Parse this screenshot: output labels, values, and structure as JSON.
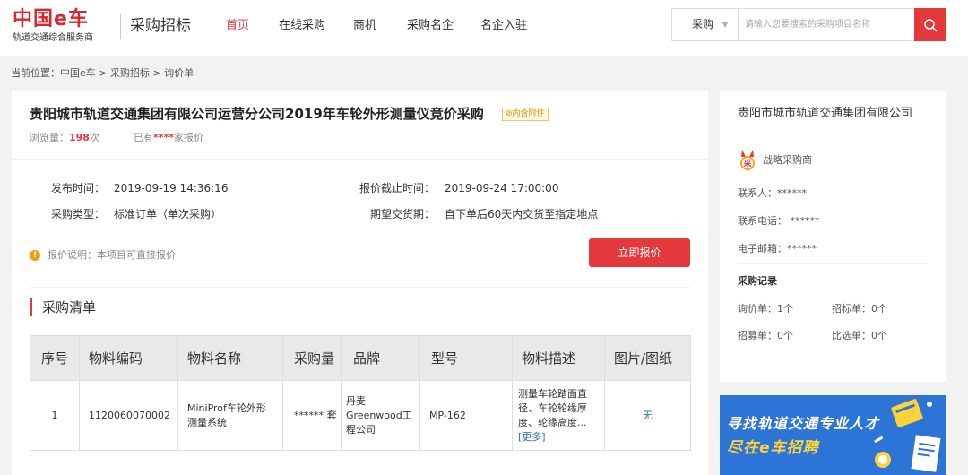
{
  "header": {
    "logo_main": "中国e车",
    "logo_sub": "轨道交通综合服务商",
    "site_title": "采购招标",
    "nav": [
      {
        "label": "首页",
        "active": true
      },
      {
        "label": "在线采购",
        "active": false
      },
      {
        "label": "商机",
        "active": false
      },
      {
        "label": "采购名企",
        "active": false
      },
      {
        "label": "名企入驻",
        "active": false
      }
    ],
    "search": {
      "category": "采购",
      "placeholder": "请输入您要搜索的采购项目名称",
      "button_icon": "search-icon"
    }
  },
  "breadcrumb": "当前位置：中国e车 > 采购招标 > 询价单",
  "project": {
    "title": "贵阳城市轨道交通集团有限公司运营分公司2019年车轮外形测量仪竞价采购",
    "badge": "内含附件",
    "views_label": "浏览量：",
    "views_count": "198",
    "views_unit": "次",
    "quote_prefix": "已有",
    "quote_stars": "****",
    "quote_suffix": "家报价",
    "publish_label": "发布时间：",
    "publish_time": "2019-09-19 14:36:16",
    "deadline_label": "报价截止时间：",
    "deadline_time": "2019-09-24 17:00:00",
    "type_label": "采购类型：",
    "type_value": "标准订单（单次采购）",
    "delivery_label": "期望交货期：",
    "delivery_value": "自下单后60天内交货至指定地点",
    "note": "报价说明：本项目可直接报价",
    "quote_button": "立即报价"
  },
  "purchase_list": {
    "title": "采购清单",
    "columns": [
      "序号",
      "物料编码",
      "物料名称",
      "采购量",
      "品牌",
      "型号",
      "物料描述",
      "图片/图纸"
    ],
    "rows": [
      {
        "index": "1",
        "code": "1120060070002",
        "name": "MiniProf车轮外形测量系统",
        "qty": "****** 套",
        "brand": "丹麦Greenwood工程公司",
        "model": "MP-162",
        "desc": "测量车轮踏面直径、车轮轮缘厚度、轮缘高度...",
        "desc_more": "[更多]",
        "image": "无"
      }
    ]
  },
  "side": {
    "company": "贵阳市城市轨道交通集团有限公司",
    "strategic": "战略采购商",
    "medal_text": "采",
    "contact_person": "联系人：******",
    "contact_phone": "联系电话：  ******",
    "contact_email": "电子邮箱：******",
    "records_title": "采购记录",
    "records": {
      "inquiry": "询价单：1个",
      "tender": "招标单：0个",
      "recruit": "招募单：0个",
      "compare": "比选单：0个"
    }
  },
  "banner": {
    "line1": "寻找轨道交通专业人才",
    "line2": "尽在e车招聘"
  },
  "colors": {
    "accent": "#e4393c",
    "badge": "#f0c75c",
    "banner_bg": "#2c74d6",
    "banner_highlight": "#ffd23a"
  }
}
